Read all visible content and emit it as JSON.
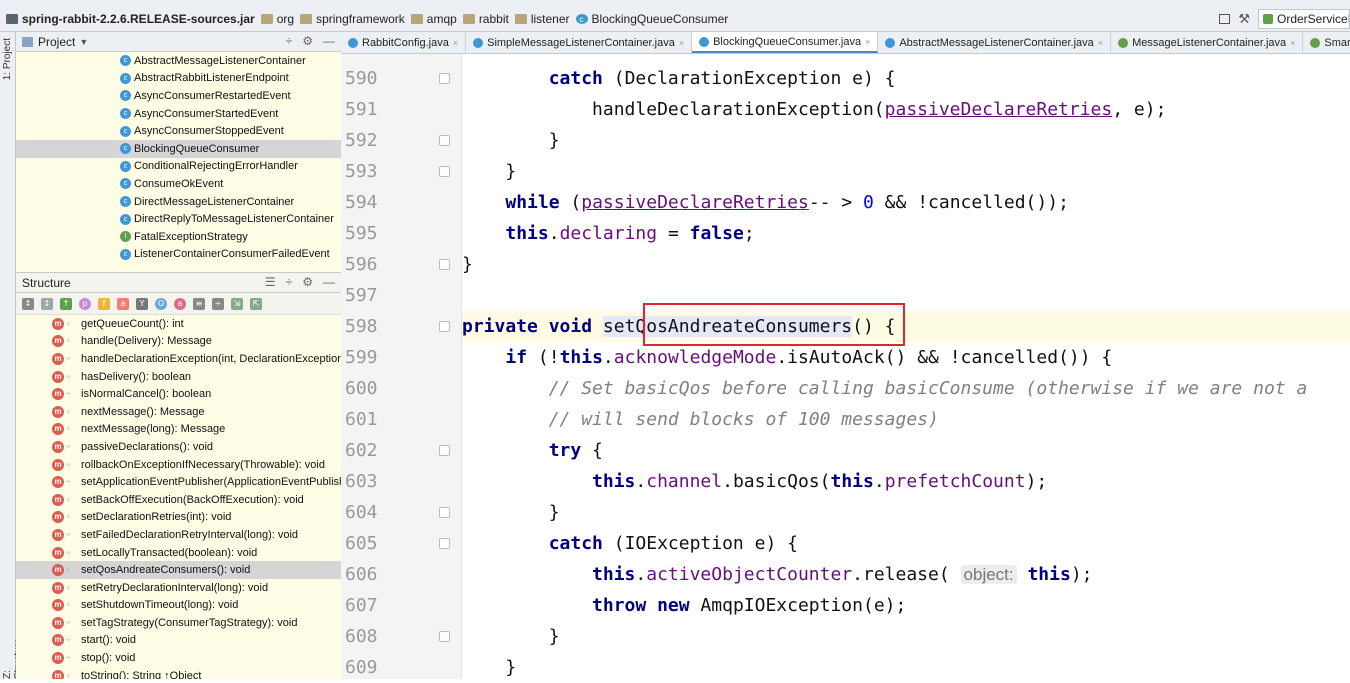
{
  "navbar": {
    "breadcrumbs": [
      "spring-rabbit-2.2.6.RELEASE-sources.jar",
      "org",
      "springframework",
      "amqp",
      "rabbit",
      "listener",
      "BlockingQueueConsumer"
    ],
    "run_config": "OrderServiceM"
  },
  "sidestrip": {
    "project_label": "1: Project",
    "structure_label": "Z: Structure"
  },
  "project_panel": {
    "title": "Project",
    "items": [
      {
        "label": "AbstractMessageListenerContainer",
        "kind": "class"
      },
      {
        "label": "AbstractRabbitListenerEndpoint",
        "kind": "class"
      },
      {
        "label": "AsyncConsumerRestartedEvent",
        "kind": "class"
      },
      {
        "label": "AsyncConsumerStartedEvent",
        "kind": "class"
      },
      {
        "label": "AsyncConsumerStoppedEvent",
        "kind": "class"
      },
      {
        "label": "BlockingQueueConsumer",
        "kind": "class",
        "selected": true
      },
      {
        "label": "ConditionalRejectingErrorHandler",
        "kind": "class"
      },
      {
        "label": "ConsumeOkEvent",
        "kind": "class"
      },
      {
        "label": "DirectMessageListenerContainer",
        "kind": "class"
      },
      {
        "label": "DirectReplyToMessageListenerContainer",
        "kind": "class"
      },
      {
        "label": "FatalExceptionStrategy",
        "kind": "interface"
      },
      {
        "label": "ListenerContainerConsumerFailedEvent",
        "kind": "class"
      }
    ]
  },
  "structure_panel": {
    "title": "Structure",
    "items": [
      "getQueueCount(): int",
      "handle(Delivery): Message",
      "handleDeclarationException(int, DeclarationException)",
      "hasDelivery(): boolean",
      "isNormalCancel(): boolean",
      "nextMessage(): Message",
      "nextMessage(long): Message",
      "passiveDeclarations(): void",
      "rollbackOnExceptionIfNecessary(Throwable): void",
      "setApplicationEventPublisher(ApplicationEventPublishe",
      "setBackOffExecution(BackOffExecution): void",
      "setDeclarationRetries(int): void",
      "setFailedDeclarationRetryInterval(long): void",
      "setLocallyTransacted(boolean): void",
      "setQosAndreateConsumers(): void",
      "setRetryDeclarationInterval(long): void",
      "setShutdownTimeout(long): void",
      "setTagStrategy(ConsumerTagStrategy): void",
      "start(): void",
      "stop(): void",
      "toString(): String ↑Object"
    ],
    "selected_index": 14
  },
  "tabs": [
    {
      "label": "RabbitConfig.java",
      "icon": "class"
    },
    {
      "label": "SimpleMessageListenerContainer.java",
      "icon": "class"
    },
    {
      "label": "BlockingQueueConsumer.java",
      "icon": "class",
      "active": true
    },
    {
      "label": "AbstractMessageListenerContainer.java",
      "icon": "class"
    },
    {
      "label": "MessageListenerContainer.java",
      "icon": "interface"
    },
    {
      "label": "SmartLi",
      "icon": "interface"
    }
  ],
  "code": {
    "line_numbers": [
      "590",
      "591",
      "592",
      "593",
      "594",
      "595",
      "596",
      "597",
      "598",
      "599",
      "600",
      "601",
      "602",
      "603",
      "604",
      "605",
      "606",
      "607",
      "608",
      "609"
    ],
    "highlighted_method": "setQosAndreateConsumers",
    "parameter_hint": "object:"
  }
}
